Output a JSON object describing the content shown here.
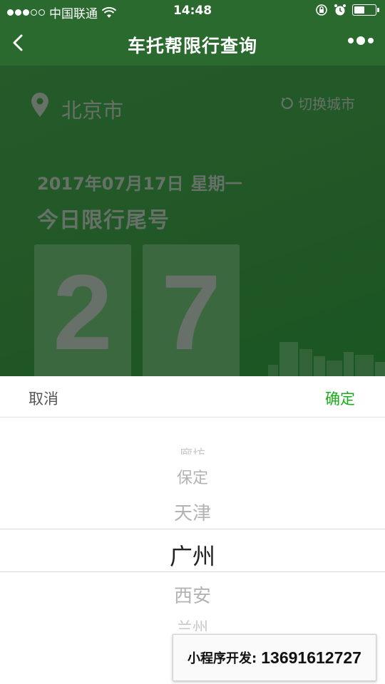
{
  "status_bar": {
    "carrier": "中国联通",
    "time": "14:48"
  },
  "nav": {
    "title": "车托帮限行查询"
  },
  "location": {
    "city": "北京市",
    "switch_label": "切换城市"
  },
  "limit": {
    "date": "2017年07月17日",
    "weekday": "星期一",
    "title": "今日限行尾号",
    "digits": [
      "2",
      "7"
    ]
  },
  "picker": {
    "cancel_label": "取消",
    "confirm_label": "确定",
    "options": [
      "廊坊",
      "保定",
      "天津",
      "广州",
      "西安",
      "兰州"
    ],
    "selected": "广州"
  },
  "ad": {
    "label": "小程序开发:",
    "phone": "13691612727"
  },
  "colors": {
    "nav_green": "#2a6a2f",
    "confirm_green": "#1aad19"
  }
}
